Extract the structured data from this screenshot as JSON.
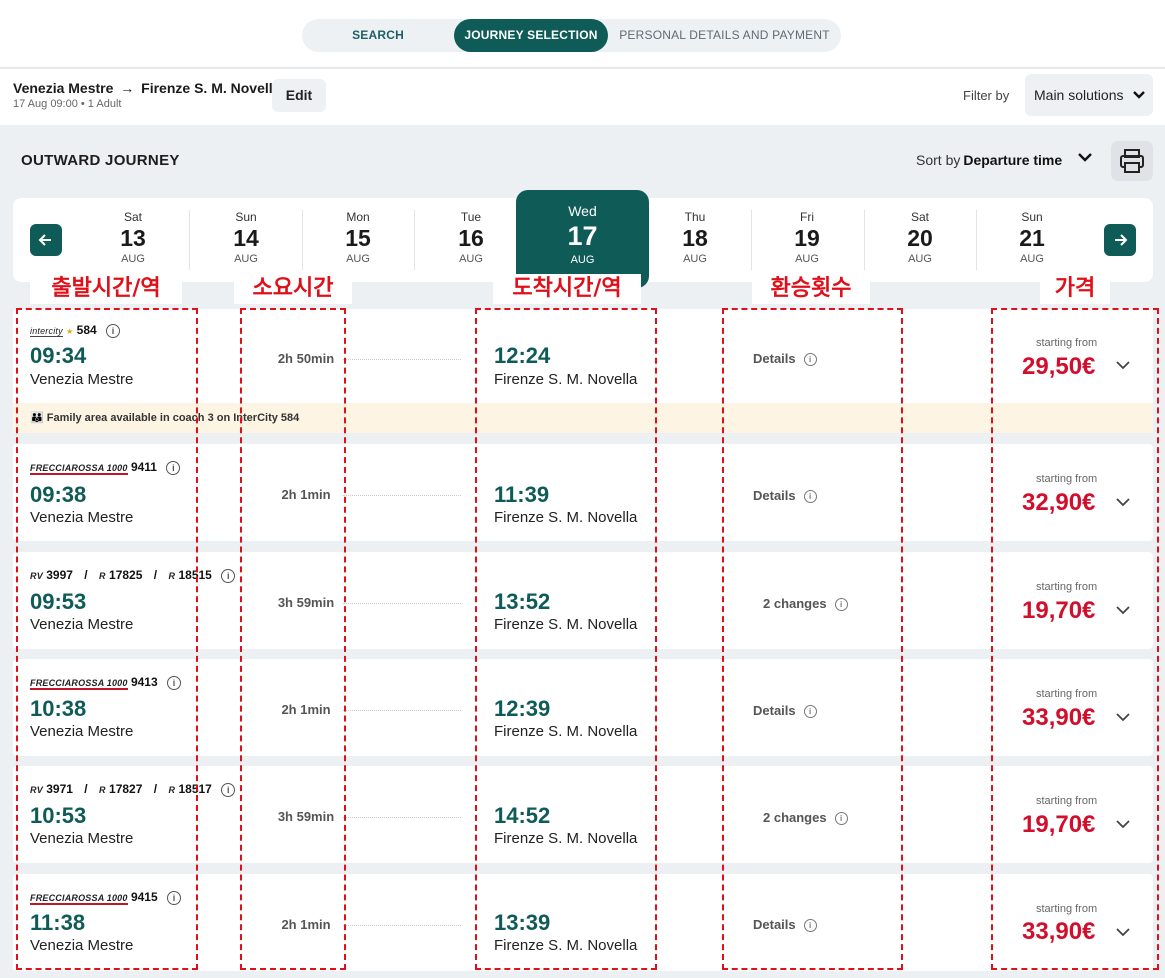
{
  "steps": {
    "search": "SEARCH",
    "journey": "JOURNEY SELECTION",
    "personal": "PERSONAL DETAILS AND PAYMENT"
  },
  "route": {
    "from": "Venezia Mestre",
    "arrow": "→",
    "to": "Firenze S. M. Novella",
    "subtitle": "17 Aug 09:00 • 1 Adult",
    "edit_label": "Edit"
  },
  "filter": {
    "label": "Filter by",
    "value": "Main solutions"
  },
  "outward": {
    "title": "OUTWARD JOURNEY",
    "sort_label": "Sort by",
    "sort_value": "Departure time"
  },
  "dates": [
    {
      "dn": "Sat",
      "dd": "13",
      "dm": "AUG"
    },
    {
      "dn": "Sun",
      "dd": "14",
      "dm": "AUG"
    },
    {
      "dn": "Mon",
      "dd": "15",
      "dm": "AUG"
    },
    {
      "dn": "Tue",
      "dd": "16",
      "dm": "AUG"
    },
    {
      "dn": "Wed",
      "dd": "17",
      "dm": "AUG"
    },
    {
      "dn": "Thu",
      "dd": "18",
      "dm": "AUG"
    },
    {
      "dn": "Fri",
      "dd": "19",
      "dm": "AUG"
    },
    {
      "dn": "Sat",
      "dd": "20",
      "dm": "AUG"
    },
    {
      "dn": "Sun",
      "dd": "21",
      "dm": "AUG"
    }
  ],
  "annotations": {
    "departure": "출발시간/역",
    "duration": "소요시간",
    "arrival": "도착시간/역",
    "changes": "환승횟수",
    "price": "가격"
  },
  "results": [
    {
      "logo1": "intercity",
      "num1": "584",
      "dep": "09:34",
      "from": "Venezia Mestre",
      "dur": "2h 50min",
      "arr": "12:24",
      "to": "Firenze S. M. Novella",
      "details": "Details",
      "starting": "starting from",
      "price": "29,50€",
      "notice": "Family area available in coach 3 on InterCity 584"
    },
    {
      "logo1": "FRECCIAROSSA 1000",
      "num1": "9411",
      "dep": "09:38",
      "from": "Venezia Mestre",
      "dur": "2h 1min",
      "arr": "11:39",
      "to": "Firenze S. M. Novella",
      "details": "Details",
      "starting": "starting from",
      "price": "32,90€"
    },
    {
      "logo1": "RV",
      "num1": "3997",
      "logo2": "R",
      "num2": "17825",
      "logo3": "R",
      "num3": "18515",
      "dep": "09:53",
      "from": "Venezia Mestre",
      "dur": "3h 59min",
      "arr": "13:52",
      "to": "Firenze S. M. Novella",
      "details": "2 changes",
      "starting": "starting from",
      "price": "19,70€"
    },
    {
      "logo1": "FRECCIAROSSA 1000",
      "num1": "9413",
      "dep": "10:38",
      "from": "Venezia Mestre",
      "dur": "2h 1min",
      "arr": "12:39",
      "to": "Firenze S. M. Novella",
      "details": "Details",
      "starting": "starting from",
      "price": "33,90€"
    },
    {
      "logo1": "RV",
      "num1": "3971",
      "logo2": "R",
      "num2": "17827",
      "logo3": "R",
      "num3": "18517",
      "dep": "10:53",
      "from": "Venezia Mestre",
      "dur": "3h 59min",
      "arr": "14:52",
      "to": "Firenze S. M. Novella",
      "details": "2 changes",
      "starting": "starting from",
      "price": "19,70€"
    },
    {
      "logo1": "FRECCIAROSSA 1000",
      "num1": "9415",
      "dep": "11:38",
      "from": "Venezia Mestre",
      "dur": "2h 1min",
      "arr": "13:39",
      "to": "Firenze S. M. Novella",
      "details": "Details",
      "starting": "starting from",
      "price": "33,90€"
    }
  ]
}
